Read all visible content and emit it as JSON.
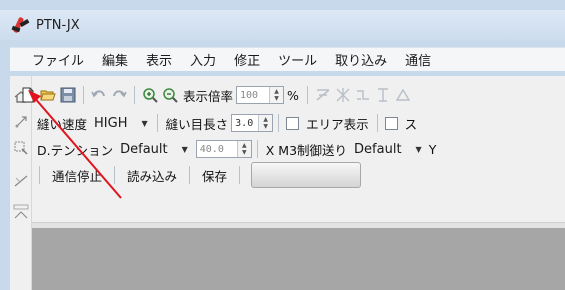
{
  "window": {
    "title": "PTN-JX"
  },
  "menu": [
    "ファイル",
    "編集",
    "表示",
    "入力",
    "修正",
    "ツール",
    "取り込み",
    "通信"
  ],
  "toolbar1": {
    "zoom_label": "表示倍率",
    "zoom_value": "100",
    "zoom_unit": "%"
  },
  "toolbar2": {
    "sew_speed_label": "縫い速度",
    "sew_speed_value": "HIGH",
    "stitch_length_label": "縫い目長さ",
    "stitch_length_value": "3.0",
    "area_display_label": "エリア表示",
    "extra_label": "ス"
  },
  "toolbar3": {
    "tension_label": "D.テンション",
    "tension_value": "Default",
    "tension_spin_value": "40.0",
    "xm3_label": "X M3制御送り",
    "xm3_value": "Default",
    "extra_label": "Y"
  },
  "toolbar4": {
    "stop_comm": "通信停止",
    "read": "読み込み",
    "save": "保存"
  },
  "colors": {
    "arrow": "#e0141e",
    "workspace": "#a6a6a6"
  }
}
